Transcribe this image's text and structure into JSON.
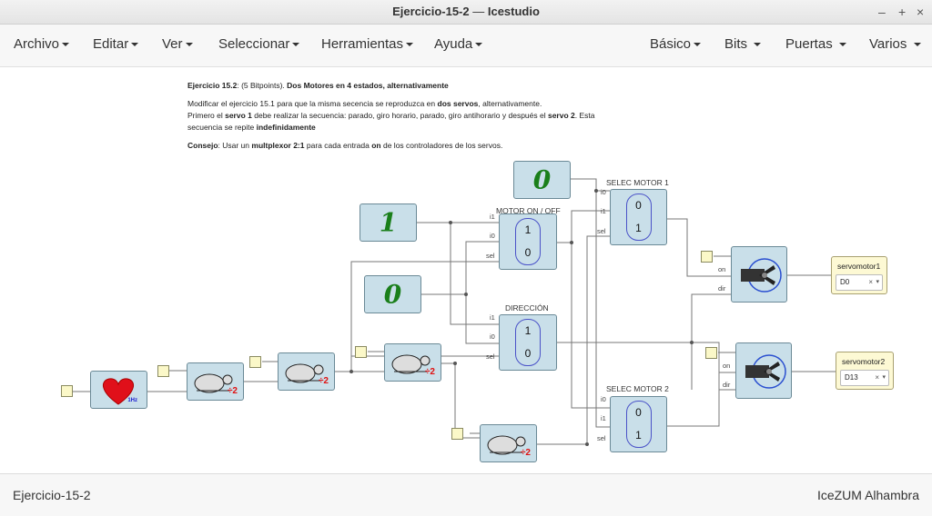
{
  "window": {
    "title": "Ejercicio-15-2",
    "app": "Icestudio",
    "separator": "—"
  },
  "window_controls": {
    "minimize": "–",
    "maximize": "+",
    "close": "×"
  },
  "menu": {
    "left": [
      "Archivo",
      "Editar",
      "Ver",
      "Seleccionar",
      "Herramientas",
      "Ayuda"
    ],
    "right": [
      "Básico",
      "Bits",
      "Puertas",
      "Varios"
    ]
  },
  "info": {
    "heading_label": "Ejercicio 15.2",
    "heading_points": ": (5 Bitpoints). ",
    "heading_title": "Dos Motores en 4 estados, alternativamente",
    "p1_a": "Modificar el ejercicio 15.1 para que la misma secencia se reproduzca en ",
    "p1_b": "dos servos",
    "p1_c": ", alternativamente.",
    "p2_a": "Primero el ",
    "p2_b": "servo 1",
    "p2_c": " debe realizar la secuencia: parado, giro horario, parado, giro antihorario y después el ",
    "p2_d": "servo 2",
    "p2_e": ". Esta secuencia se repite ",
    "p2_f": "indefinidamente",
    "p3_a": "Consejo",
    "p3_b": ": Usar un ",
    "p3_c": "multplexor 2:1",
    "p3_d": " para cada entrada ",
    "p3_e": "on",
    "p3_f": " de los controladores de los servos."
  },
  "blocks": {
    "const_zero_top": "0",
    "const_one": "1",
    "const_zero_mid": "0",
    "heart_label": "1Hz",
    "divider_label": "÷2",
    "mux_motor_on_off": {
      "title": "MOTOR ON / OFF",
      "top": "1",
      "bottom": "0"
    },
    "mux_direccion": {
      "title": "DIRECCIÓN",
      "top": "1",
      "bottom": "0"
    },
    "mux_selec_motor1": {
      "title": "SELEC MOTOR 1",
      "top": "0",
      "bottom": "1"
    },
    "mux_selec_motor2": {
      "title": "SELEC MOTOR 2",
      "top": "0",
      "bottom": "1"
    },
    "pins": {
      "i0": "i0",
      "i1": "i1",
      "sel": "sel",
      "on": "on",
      "dir": "dir"
    }
  },
  "outputs": {
    "servo1": {
      "label": "servomotor1",
      "pin": "D0",
      "clear": "×",
      "dropdown": "▾"
    },
    "servo2": {
      "label": "servomotor2",
      "pin": "D13",
      "clear": "×",
      "dropdown": "▾"
    }
  },
  "status": {
    "left": "Ejercicio-15-2",
    "right": "IceZUM Alhambra"
  },
  "colors": {
    "block_fill": "#c9dfe9",
    "mux_ring": "#4a52c8",
    "const_glyph": "#1a7f1a",
    "heart": "#e0101a",
    "divider": "#e01010"
  }
}
